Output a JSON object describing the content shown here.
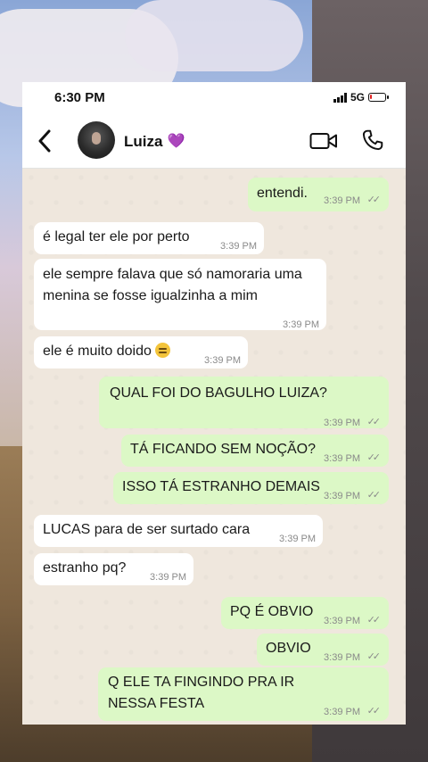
{
  "status_bar": {
    "time": "6:30 PM",
    "network": "5G",
    "battery_level": 0.15,
    "battery_color": "#e02020"
  },
  "header": {
    "back_icon": "chevron-left-icon",
    "contact_name": "Luiza",
    "name_emoji": "💜",
    "video_icon": "video-camera-icon",
    "call_icon": "phone-icon"
  },
  "colors": {
    "incoming_bubble": "#ffffff",
    "outgoing_bubble": "#dcf8c6",
    "chat_background": "#efe7dd"
  },
  "messages": [
    {
      "dir": "out",
      "text": "entendi.",
      "time": "3:39 PM"
    },
    {
      "dir": "in",
      "text": "é legal ter ele por perto",
      "time": "3:39 PM"
    },
    {
      "dir": "in",
      "text": "ele sempre falava que só namoraria uma menina se fosse igualzinha a mim",
      "time": "3:39 PM"
    },
    {
      "dir": "in",
      "text": "ele é muito doido",
      "emoji": "😔",
      "time": "3:39 PM"
    },
    {
      "dir": "out",
      "text": "QUAL FOI DO BAGULHO LUIZA?",
      "time": "3:39 PM"
    },
    {
      "dir": "out",
      "text": "TÁ FICANDO SEM NOÇÃO?",
      "time": "3:39 PM"
    },
    {
      "dir": "out",
      "text": "ISSO TÁ ESTRANHO DEMAIS",
      "time": "3:39 PM"
    },
    {
      "dir": "in",
      "text": "LUCAS para de ser surtado cara",
      "time": "3:39 PM"
    },
    {
      "dir": "in",
      "text": "estranho pq?",
      "time": "3:39 PM"
    },
    {
      "dir": "out",
      "text": "PQ É OBVIO",
      "time": "3:39 PM"
    },
    {
      "dir": "out",
      "text": "OBVIO",
      "time": "3:39 PM"
    },
    {
      "dir": "out",
      "text": "Q ELE TA FINGINDO PRA IR NESSA FESTA",
      "time": "3:39 PM"
    }
  ]
}
